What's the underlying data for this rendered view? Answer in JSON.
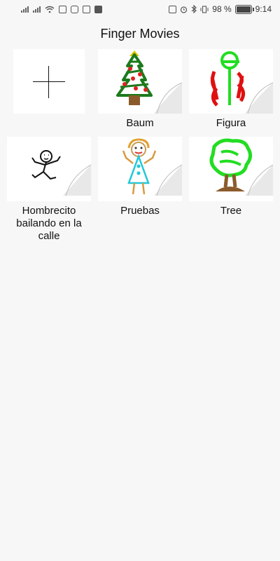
{
  "status_bar": {
    "battery": "98 %",
    "time": "9:14",
    "left_icons": [
      "signal-icon",
      "signal-icon",
      "wifi-icon",
      "message-icon",
      "instagram-icon",
      "photo-icon",
      "mail-icon"
    ],
    "right_icons": [
      "nfc-icon",
      "alarm-icon",
      "bluetooth-icon",
      "vibrate-icon",
      "battery-icon"
    ]
  },
  "app": {
    "title": "Finger Movies"
  },
  "movies": [
    {
      "label": "Baum",
      "thumbnail": "christmas-tree-drawing"
    },
    {
      "label": "Figura",
      "thumbnail": "green-red-figure-drawing"
    },
    {
      "label": "Hombrecito bailando en la calle",
      "thumbnail": "stick-man-drawing"
    },
    {
      "label": "Pruebas",
      "thumbnail": "girl-figure-drawing"
    },
    {
      "label": "Tree",
      "thumbnail": "green-tree-drawing"
    }
  ],
  "add_tile": {
    "icon": "plus-icon"
  }
}
